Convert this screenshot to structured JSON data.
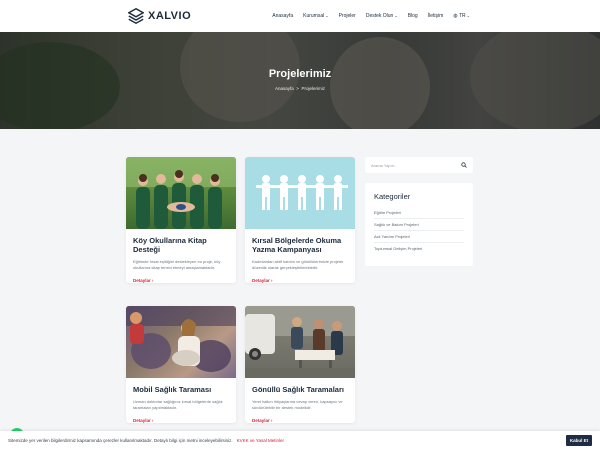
{
  "brand": {
    "name": "XALVIO"
  },
  "nav": {
    "items": [
      {
        "label": "Anasayfa",
        "caret": false
      },
      {
        "label": "Kurumsal",
        "caret": true
      },
      {
        "label": "Projeler",
        "caret": false
      },
      {
        "label": "Destek Olun",
        "caret": true
      },
      {
        "label": "Blog",
        "caret": false
      },
      {
        "label": "İletişim",
        "caret": false
      }
    ],
    "language": "TR",
    "caret_glyph": "⌄"
  },
  "hero": {
    "title": "Projelerimiz",
    "breadcrumb_home": "Anasayfa",
    "breadcrumb_sep": ">",
    "breadcrumb_current": "Projelerimiz"
  },
  "cards": [
    {
      "title": "Köy Okullarına Kitap Desteği",
      "desc": "Eğitimde fırsat eşitliğini destekleyen bu proje, köy okullarına kitap temini etmeyi amaçlamaktadır.",
      "more": "Detaylar  ›"
    },
    {
      "title": "Kırsal Bölgelerde Okuma Yazma Kampanyası",
      "desc": "Kadınlardan aktif katılım ve gönüllülerimizle projeler düzenlik olarak gerçekleştirilmektedir.",
      "more": "Detaylar  ›"
    },
    {
      "title": "Mobil Sağlık Taraması",
      "desc": "Uzman doktorlar sağlığınız kırsal bölgelerde sağlık taramaları yapılmaktadır.",
      "more": "Detaylar  ›"
    },
    {
      "title": "Gönüllü Sağlık Taramaları",
      "desc": "Yerel halkın ihtiyaçlarına cevap veren, kapsayıcı ve sürdürülebilir bir destek modelidir.",
      "more": "Detaylar  ›"
    }
  ],
  "sidebar": {
    "search_placeholder": "Arama Yapın...",
    "categories_title": "Kategoriler",
    "categories": [
      "Eğitim Projeleri",
      "Sağlık ve Bakım Projeleri",
      "Acil Yardım Projeleri",
      "Toplumsal Gelişim Projeleri"
    ]
  },
  "cookie": {
    "text": "Sitemizde yer verilen bilgilerdirmiz kapsamında çerezler kullanılmaktadır. Detaylı bilgi için metni inceleyebilirsiniz.",
    "link": "KVKK ve Yasal Metinler",
    "button": "Kabul Et"
  },
  "colors": {
    "accent": "#d0243a",
    "dark": "#1f2d44",
    "whatsapp": "#25d366"
  }
}
